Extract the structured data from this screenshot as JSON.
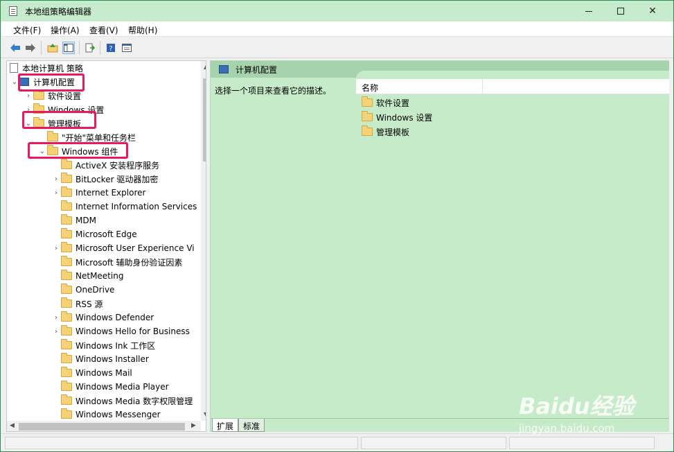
{
  "window": {
    "title": "本地组策略编辑器",
    "controls": {
      "minimize": "—",
      "maximize": "☐",
      "close": "✕"
    }
  },
  "menu": [
    "文件(F)",
    "操作(A)",
    "查看(V)",
    "帮助(H)"
  ],
  "toolbar_icons": [
    "back-arrow-icon",
    "forward-arrow-icon",
    "up-folder-icon",
    "show-hide-tree-icon",
    "export-list-icon",
    "help-icon",
    "properties-icon"
  ],
  "tree": {
    "root": "本地计算机 策略",
    "computer_config": "计算机配置",
    "software_settings": "软件设置",
    "windows_settings": "Windows 设置",
    "admin_templates": "管理模板",
    "start_menu": "\"开始\"菜单和任务栏",
    "windows_components": "Windows 组件",
    "components": [
      "ActiveX 安装程序服务",
      "BitLocker 驱动器加密",
      "Internet Explorer",
      "Internet Information Services",
      "MDM",
      "Microsoft Edge",
      "Microsoft User Experience Vi",
      "Microsoft 辅助身份验证因素",
      "NetMeeting",
      "OneDrive",
      "RSS 源",
      "Windows Defender",
      "Windows Hello for Business",
      "Windows Ink 工作区",
      "Windows Installer",
      "Windows Mail",
      "Windows Media Player",
      "Windows Media 数字权限管理",
      "Windows Messenger"
    ]
  },
  "right_pane": {
    "header": "计算机配置",
    "description": "选择一个项目来查看它的描述。",
    "column_name": "名称",
    "items": [
      "软件设置",
      "Windows 设置",
      "管理模板"
    ],
    "tabs": [
      "扩展",
      "标准"
    ]
  },
  "watermark": {
    "main": "Baidu经验",
    "sub": "jingyan.baidu.com"
  },
  "colors": {
    "highlight": "#e8195d",
    "pane_green": "#c6ebc9",
    "title_green": "#c7ebcd"
  }
}
